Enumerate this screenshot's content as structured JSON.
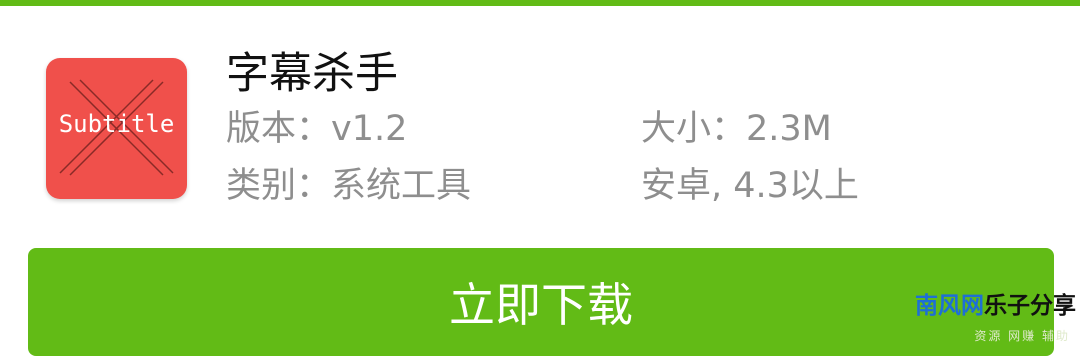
{
  "app": {
    "name": "字幕杀手",
    "icon_text": "Subtitle",
    "icon_name": "crossed-subtitle-icon"
  },
  "meta": {
    "version": "版本：v1.2",
    "size": "大小：2.3M",
    "category": "类别：系统工具",
    "android": "安卓, 4.3以上"
  },
  "download": {
    "label": "立即下载"
  },
  "watermark": {
    "title_blue": "南风网",
    "title_dark": "乐子分享",
    "subtitle": "资源 网赚 辅助"
  },
  "colors": {
    "accent": "#62bb16",
    "icon_bg": "#f0504b",
    "meta_text": "#8e8e8e",
    "watermark_blue": "#1e6fd6"
  }
}
